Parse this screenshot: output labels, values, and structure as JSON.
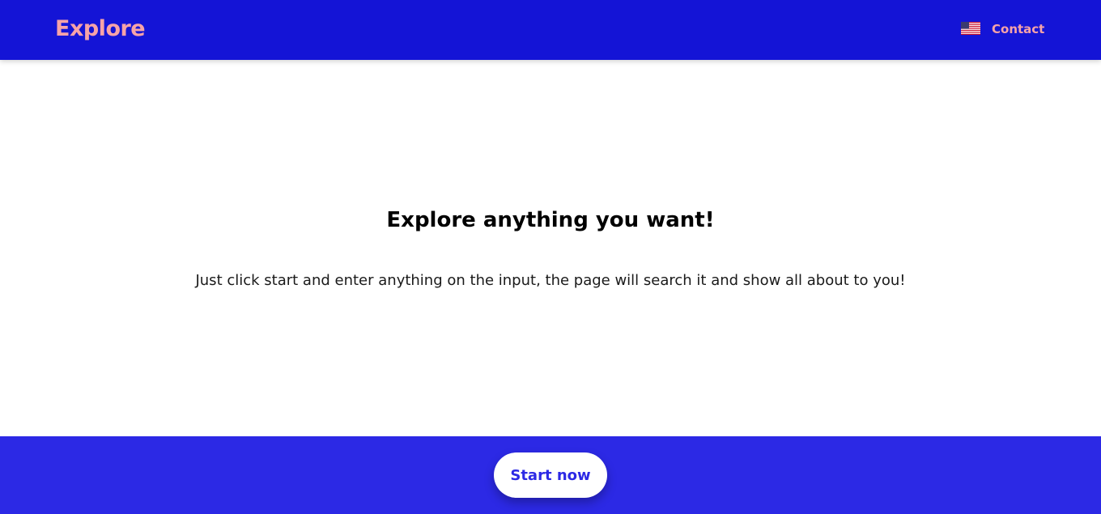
{
  "header": {
    "logo": "Explore",
    "flag_icon": "us-flag-icon",
    "contact_label": "Contact"
  },
  "hero": {
    "headline": "Explore anything you want!",
    "subtext": "Just click start and enter anything on the input, the page will search it and show all about to you!"
  },
  "footer": {
    "start_label": "Start now"
  },
  "colors": {
    "header_bg": "#1414d6",
    "footer_bg": "#2c29e5",
    "accent_pink": "#f6a3a8",
    "button_text": "#2c29e5"
  }
}
